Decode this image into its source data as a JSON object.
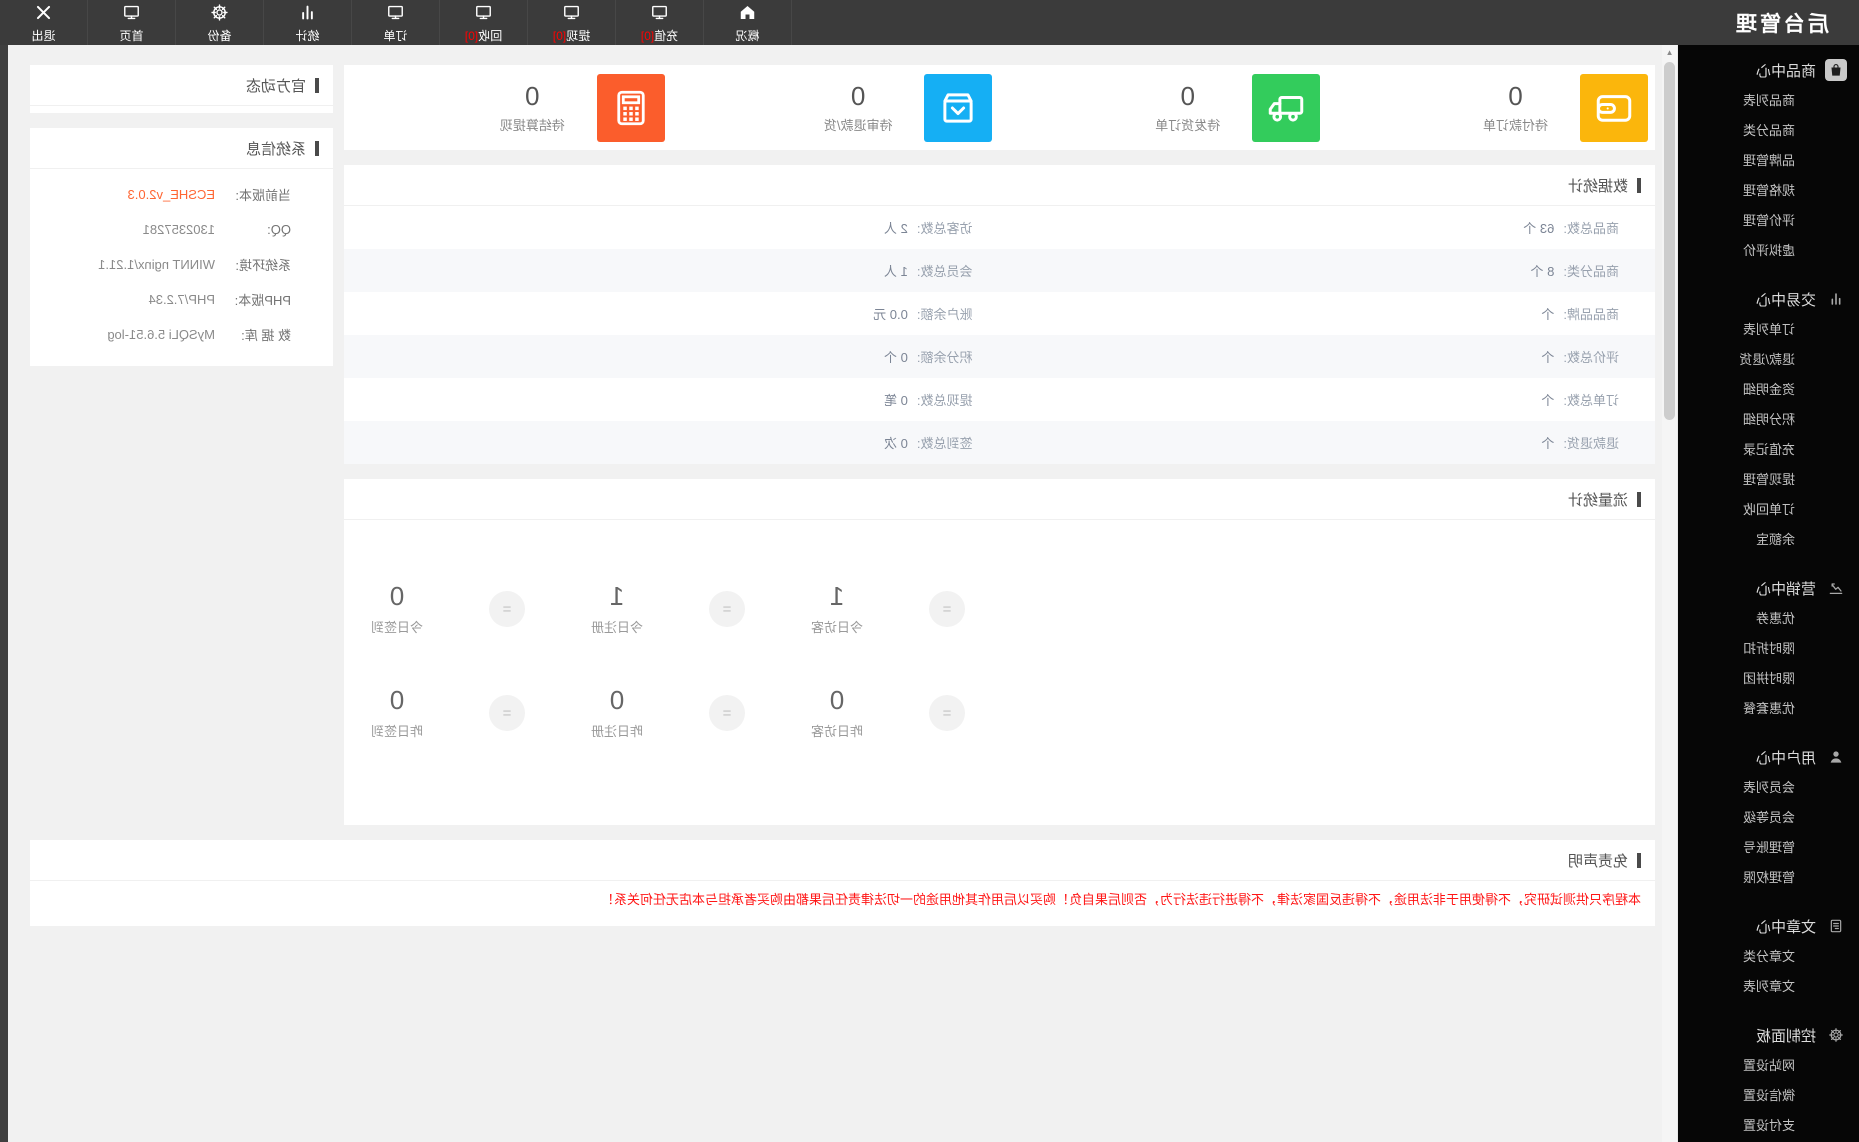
{
  "app": {
    "logo": "后台管理"
  },
  "toolbar": {
    "items": [
      {
        "label": "概况",
        "icon": "home-icon"
      },
      {
        "label": "充值",
        "badge": "[0]",
        "icon": "monitor-icon"
      },
      {
        "label": "提现",
        "badge": "[0]",
        "icon": "monitor-icon"
      },
      {
        "label": "回收",
        "badge": "[0]",
        "icon": "monitor-icon"
      },
      {
        "label": "订单",
        "icon": "monitor-icon"
      },
      {
        "label": "统计",
        "icon": "bar-chart-icon"
      },
      {
        "label": "备份",
        "icon": "gear-icon"
      },
      {
        "label": "首页",
        "icon": "monitor-icon"
      },
      {
        "label": "退出",
        "icon": "close-icon"
      }
    ]
  },
  "sidebar": {
    "sections": [
      {
        "title": "商品中心",
        "icon": "shopping-bag-icon",
        "items": [
          "商品列表",
          "商品分类",
          "品牌管理",
          "规格管理",
          "评价管理",
          "虚拟评价"
        ]
      },
      {
        "title": "交易中心",
        "icon": "bar-chart-icon",
        "items": [
          "订单列表",
          "退款/退货",
          "资金明细",
          "积分明细",
          "充值记录",
          "提现管理",
          "订单回收",
          "余额宝"
        ]
      },
      {
        "title": "营销中心",
        "icon": "trend-chart-icon",
        "items": [
          "优惠券",
          "限时折扣",
          "限时拼团",
          "优惠套餐"
        ]
      },
      {
        "title": "用户中心",
        "icon": "user-icon",
        "items": [
          "会员列表",
          "会员等级",
          "管理账号",
          "管理权限"
        ]
      },
      {
        "title": "文章中心",
        "icon": "document-icon",
        "items": [
          "文章分类",
          "文章列表"
        ]
      },
      {
        "title": "控制面板",
        "icon": "gear-icon",
        "items": [
          "网站设置",
          "微信设置",
          "支付设置"
        ]
      }
    ]
  },
  "summary_cards": [
    {
      "value": "0",
      "label": "待付款订单",
      "color": "#fbb60c",
      "icon": "wallet-icon"
    },
    {
      "value": "0",
      "label": "待发货订单",
      "color": "#33cc5c",
      "icon": "truck-icon"
    },
    {
      "value": "0",
      "label": "待审退款/货",
      "color": "#15aff4",
      "icon": "package-icon"
    },
    {
      "value": "0",
      "label": "待结算提现",
      "color": "#fb5d2c",
      "icon": "calculator-icon"
    }
  ],
  "data_stats": {
    "title": "数据统计",
    "rows": [
      {
        "c1_label": "商品总数:",
        "c1_value": "63 个",
        "c2_label": "访客总数:",
        "c2_value": "2 人"
      },
      {
        "c1_label": "商品分类:",
        "c1_value": "8 个",
        "c2_label": "会员总数:",
        "c2_value": "1 人"
      },
      {
        "c1_label": "商品品牌:",
        "c1_value": "个",
        "c2_label": "账户余额:",
        "c2_value": "0.0 元"
      },
      {
        "c1_label": "评价总数:",
        "c1_value": "个",
        "c2_label": "积分余额:",
        "c2_value": "0 个"
      },
      {
        "c1_label": "订单总数:",
        "c1_value": "个",
        "c2_label": "提现总数:",
        "c2_value": "0 笔"
      },
      {
        "c1_label": "退款退货:",
        "c1_value": "个",
        "c2_label": "签到总数:",
        "c2_value": "0 次"
      }
    ]
  },
  "flow_stats": {
    "title": "流量统计",
    "separator_glyph": "=",
    "rows": [
      [
        {
          "value": "1",
          "label": "今日访客"
        },
        {
          "value": "1",
          "label": "今日注册"
        },
        {
          "value": "0",
          "label": "今日签到"
        }
      ],
      [
        {
          "value": "0",
          "label": "昨日访客"
        },
        {
          "value": "0",
          "label": "昨日注册"
        },
        {
          "value": "0",
          "label": "昨日签到"
        }
      ]
    ]
  },
  "disclaimer": {
    "title": "免责声明",
    "text": "本程序只供测试研究，不得使用于非法用途，不得违反国家法律，不得进行违法行为，否则后果自负！购买以后用作其他用途的一切法律责任后果都由购买者承担与本店无任何关系！"
  },
  "side_panel": {
    "news": {
      "title": "官方动态"
    },
    "system": {
      "title": "系统信息",
      "rows": [
        {
          "label": "当前版本:",
          "value": "ECSHE_v2.0.3"
        },
        {
          "label": "QQ:",
          "value": "1302357281"
        },
        {
          "label": "系统环境:",
          "value": "WINNT nginx/1.21.1"
        },
        {
          "label": "PHP版本:",
          "value": "PHP/7.2.34"
        },
        {
          "label": "数 据 库:",
          "value": "MySQLi 5.6.51-log"
        }
      ]
    }
  },
  "colors": {
    "topbar_bg": "#3b3b3b",
    "sidebar_bg": "#060606",
    "page_bg": "#f1f1f1",
    "badge_red": "#ff0000",
    "disclaimer_red": "#ff1616",
    "version_highlight": "#ff6633",
    "card_yellow": "#fbb60c",
    "card_green": "#33cc5c",
    "card_blue": "#15aff4",
    "card_orange": "#fb5d2c"
  },
  "note": "screenshot is horizontally mirrored"
}
